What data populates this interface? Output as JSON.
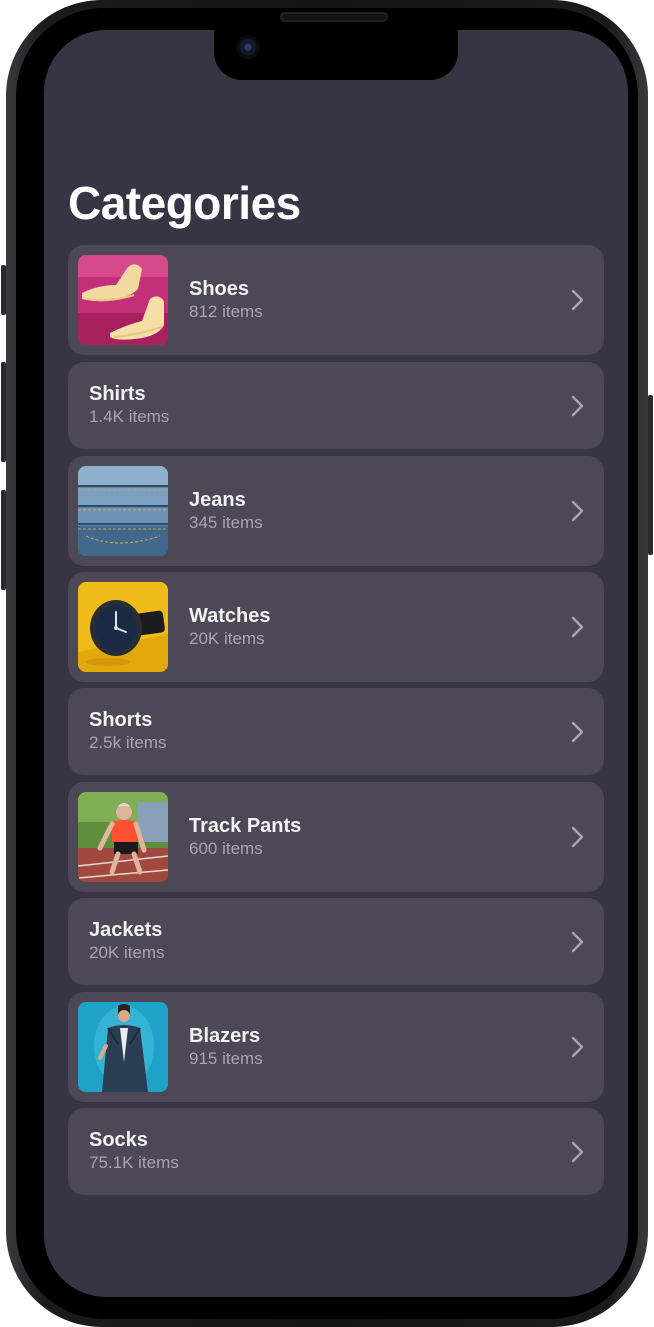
{
  "page": {
    "title": "Categories"
  },
  "categories": [
    {
      "name": "Shoes",
      "count": "812 items",
      "has_image": true,
      "image": "shoes-photo"
    },
    {
      "name": "Shirts",
      "count": "1.4K items",
      "has_image": false
    },
    {
      "name": "Jeans",
      "count": "345 items",
      "has_image": true,
      "image": "jeans-photo"
    },
    {
      "name": "Watches",
      "count": "20K items",
      "has_image": true,
      "image": "watch-photo"
    },
    {
      "name": "Shorts",
      "count": "2.5k items",
      "has_image": false
    },
    {
      "name": "Track Pants",
      "count": "600 items",
      "has_image": true,
      "image": "runner-photo"
    },
    {
      "name": "Jackets",
      "count": "20K items",
      "has_image": false
    },
    {
      "name": "Blazers",
      "count": "915 items",
      "has_image": true,
      "image": "blazer-photo"
    },
    {
      "name": "Socks",
      "count": "75.1K items",
      "has_image": false
    }
  ],
  "icons": {
    "row_action": "chevron-right-icon"
  },
  "colors": {
    "screen_background": "#373444",
    "row_background": "#4c4856",
    "title_text": "#ffffff",
    "secondary_text": "#a9a6b3"
  }
}
